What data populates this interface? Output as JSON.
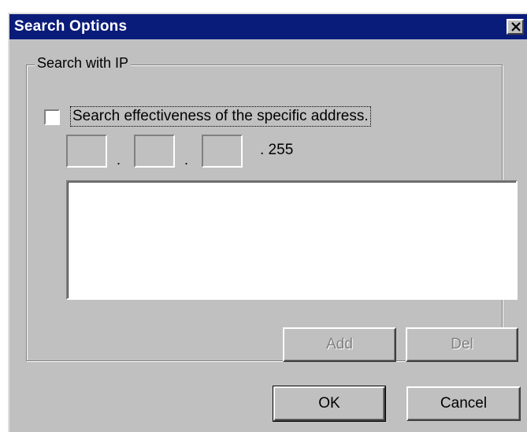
{
  "window": {
    "title": "Search Options",
    "close_glyph": "✕"
  },
  "group": {
    "label": "Search with IP",
    "checkbox_label": "Search effectiveness of the specific address.",
    "checkbox_checked": false,
    "ip_octets": [
      "",
      "",
      ""
    ],
    "ip_separator": ".",
    "ip_last_octet": ". 255",
    "list_items": [],
    "add_label": "Add",
    "del_label": "Del"
  },
  "footer": {
    "ok_label": "OK",
    "cancel_label": "Cancel"
  },
  "colors": {
    "titlebar": "#0a1c7a",
    "face": "#c0c0c0"
  }
}
